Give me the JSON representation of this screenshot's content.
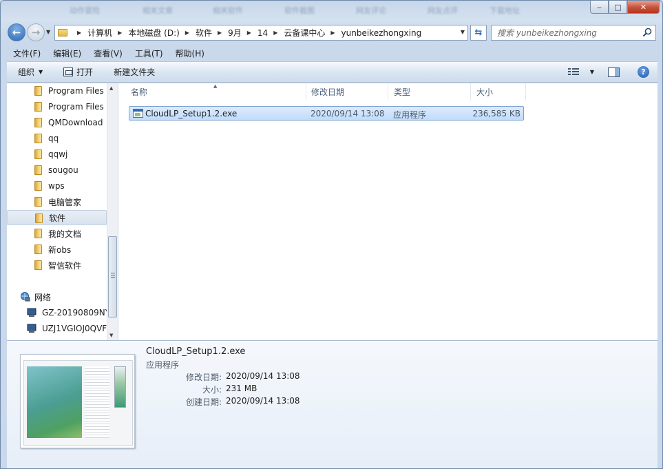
{
  "window": {
    "background_tabs": [
      "动作冒险",
      "相关文章",
      "相关软件",
      "软件截图",
      "网友评论",
      "网友点评",
      "下载地址"
    ],
    "controls": {
      "minimize": "‒",
      "maximize": "□",
      "close": "✕"
    }
  },
  "address": {
    "crumbs": [
      "计算机",
      "本地磁盘 (D:)",
      "软件",
      "9月",
      "14",
      "云备课中心",
      "yunbeikezhongxing"
    ],
    "search_placeholder": "搜索 yunbeikezhongxing"
  },
  "menu": [
    "文件(F)",
    "编辑(E)",
    "查看(V)",
    "工具(T)",
    "帮助(H)"
  ],
  "toolbar": {
    "organize": "组织",
    "open": "打开",
    "new_folder": "新建文件夹"
  },
  "nav": {
    "folders": [
      "Program Files",
      "Program Files",
      "QMDownload",
      "qq",
      "qqwj",
      "sougou",
      "wps",
      "电脑管家",
      "软件",
      "我的文档",
      "新obs",
      "智信软件"
    ],
    "selected": "软件",
    "network_label": "网络",
    "computers": [
      "GZ-20190809NY",
      "UZJ1VGIOJ0QVF"
    ]
  },
  "columns": {
    "name": "名称",
    "date": "修改日期",
    "type": "类型",
    "size": "大小"
  },
  "files": [
    {
      "name": "CloudLP_Setup1.2.exe",
      "date": "2020/09/14 13:08",
      "type": "应用程序",
      "size": "236,585 KB"
    }
  ],
  "details": {
    "name": "CloudLP_Setup1.2.exe",
    "type": "应用程序",
    "modified_label": "修改日期:",
    "modified": "2020/09/14 13:08",
    "size_label": "大小:",
    "size": "231 MB",
    "created_label": "创建日期:",
    "created": "2020/09/14 13:08"
  }
}
